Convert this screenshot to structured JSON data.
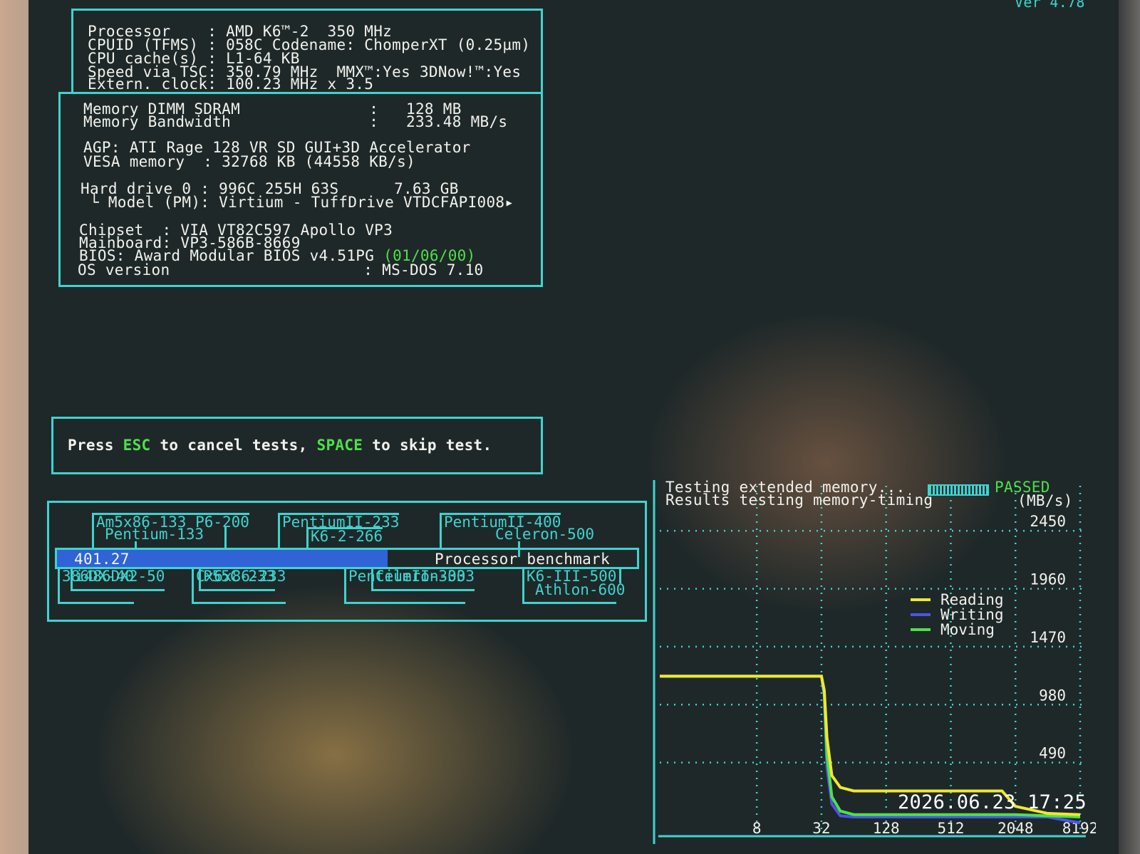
{
  "version": "Ver 4.78",
  "cpu": {
    "line1": "Processor    : AMD K6™-2  350 MHz",
    "line2": "CPUID (TFMS) : 058C Codename: ChomperXT (0.25µm)",
    "line3": "CPU cache(s) : L1-64 KB",
    "line4": "Speed via TSC: 350.79 MHz  MMX™:Yes 3DNow!™:Yes",
    "line5": "Extern. clock: 100.23 MHz x 3.5"
  },
  "system": {
    "mem_type": "Memory DIMM SDRAM              :   128 MB",
    "mem_bw": "Memory Bandwidth               :   233.48 MB/s",
    "agp": "AGP: ATI Rage 128 VR SD GUI+3D Accelerator",
    "vesa": "VESA memory  : 32768 KB (44558 KB/s)",
    "hdd": "Hard drive 0 : 996C 255H 63S      7.63 GB",
    "hdd_model": " └ Model (PM): Virtium - TuffDrive VTDCFAPI008▸",
    "chipset": "Chipset  : VIA VT82C597 Apollo VP3",
    "mainboard": "Mainboard: VP3-586B-8669",
    "bios": "BIOS: Award Modular BIOS v4.51PG ",
    "bios_date": "(01/06/00)",
    "os": "OS version                     : MS-DOS 7.10"
  },
  "prompt": {
    "p1": "Press ",
    "esc": "ESC",
    "p2": " to cancel tests, ",
    "space": "SPACE",
    "p3": " to skip test."
  },
  "benchmark": {
    "value": "401.27",
    "label": "Processor benchmark",
    "progress": 0.57,
    "top_refs": [
      "Am5x86-133 P6-200",
      "Pentium-133",
      "PentiumII-233",
      "K6-2-266",
      "PentiumII-400",
      "Celeron-500"
    ],
    "bottom_refs": [
      "i486DX2-50",
      "386DX-40",
      "P55C-233",
      "Cx6x86-233",
      "Celeron-333",
      "PentiumII-300",
      "Athlon-600",
      "K6-III-500"
    ]
  },
  "memtest": {
    "status_label": "Testing extended memory...",
    "status_result": "PASSED",
    "results_label": "Results testing memory-timing",
    "unit": "(MB/s)",
    "timestamp": "2026.06.23 17:25"
  },
  "chart_data": {
    "type": "line",
    "title": "Results testing memory-timing",
    "ylabel": "(MB/s)",
    "xlabel": "",
    "x_ticks": [
      "8",
      "32",
      "128",
      "512",
      "2048",
      "8192"
    ],
    "y_ticks": [
      490,
      980,
      1470,
      1960,
      2450
    ],
    "ylim": [
      0,
      2650
    ],
    "x": [
      1,
      4,
      8,
      16,
      24,
      32,
      34,
      36,
      40,
      48,
      64,
      96,
      128,
      256,
      512,
      1024,
      1536,
      2048,
      4096,
      8192
    ],
    "series": [
      {
        "name": "Reading",
        "color": "#f0e830",
        "values": [
          1220,
          1220,
          1220,
          1220,
          1220,
          1220,
          1100,
          700,
          380,
          280,
          250,
          250,
          250,
          250,
          250,
          250,
          250,
          120,
          60,
          50
        ]
      },
      {
        "name": "Writing",
        "color": "#4b55e8",
        "values": [
          1220,
          1220,
          1220,
          1220,
          1220,
          1220,
          1050,
          450,
          140,
          40,
          30,
          30,
          30,
          30,
          30,
          30,
          30,
          30,
          30,
          -20
        ]
      },
      {
        "name": "Moving",
        "color": "#4fe04a",
        "values": [
          1220,
          1220,
          1220,
          1220,
          1220,
          1220,
          1080,
          550,
          200,
          80,
          50,
          50,
          50,
          50,
          50,
          50,
          50,
          50,
          40,
          30
        ]
      }
    ],
    "grid": true,
    "legend": "center-right"
  }
}
